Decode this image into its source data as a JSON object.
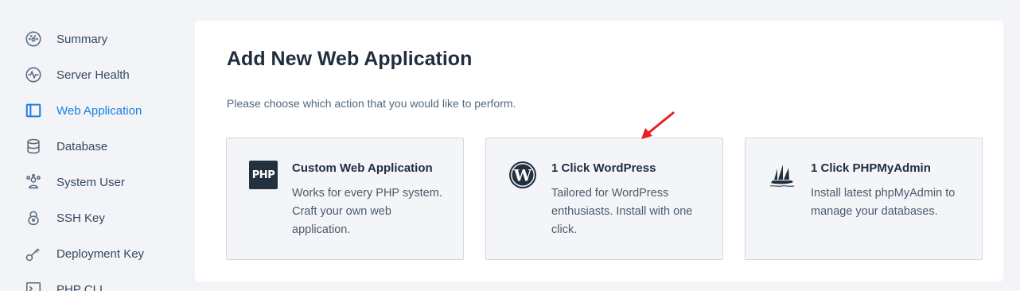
{
  "sidebar": {
    "items": [
      {
        "label": "Summary",
        "icon": "gauge-icon"
      },
      {
        "label": "Server Health",
        "icon": "pulse-icon"
      },
      {
        "label": "Web Application",
        "icon": "window-icon",
        "active": true
      },
      {
        "label": "Database",
        "icon": "database-icon"
      },
      {
        "label": "System User",
        "icon": "users-icon"
      },
      {
        "label": "SSH Key",
        "icon": "lock-icon"
      },
      {
        "label": "Deployment Key",
        "icon": "key-icon"
      },
      {
        "label": "PHP CLI",
        "icon": "terminal-icon"
      }
    ]
  },
  "main": {
    "title": "Add New Web Application",
    "subtitle": "Please choose which action that you would like to perform.",
    "cards": [
      {
        "title": "Custom Web Application",
        "description": "Works for every PHP system. Craft your own web application.",
        "icon": "php-icon",
        "icon_text": "PHP"
      },
      {
        "title": "1 Click WordPress",
        "description": "Tailored for WordPress enthusiasts. Install with one click.",
        "icon": "wordpress-icon"
      },
      {
        "title": "1 Click PHPMyAdmin",
        "description": "Install latest phpMyAdmin to manage your databases.",
        "icon": "sailboat-icon"
      }
    ]
  },
  "colors": {
    "accent": "#1b7fdc",
    "annotation_arrow": "#e8201e",
    "background": "#f3f4f8",
    "card_background": "#f4f5f9"
  }
}
